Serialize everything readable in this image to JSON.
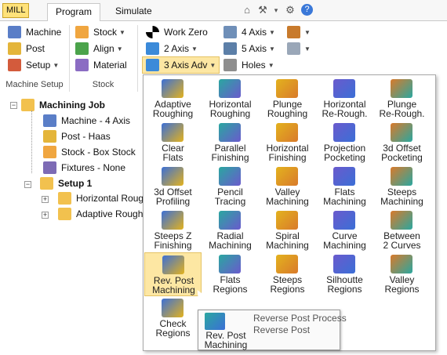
{
  "ribbon": {
    "app_badge": "MILL",
    "tabs": [
      {
        "label": "Program"
      },
      {
        "label": "Simulate"
      }
    ],
    "machine_setup": {
      "machine": "Machine",
      "post": "Post",
      "setup": "Setup",
      "group": "Machine Setup"
    },
    "stock": {
      "stock": "Stock",
      "align": "Align",
      "material": "Material",
      "group": "Stock"
    },
    "programming": {
      "work_zero": "Work Zero",
      "two_axis": "2 Axis",
      "three_axis_adv": "3 Axis Adv",
      "four_axis": "4 Axis",
      "five_axis": "5 Axis",
      "holes": "Holes"
    }
  },
  "tree": {
    "job": "Machining Job",
    "machine": "Machine - 4 Axis",
    "post": "Post - Haas",
    "stock": "Stock - Box Stock",
    "fixtures": "Fixtures - None",
    "setup": "Setup 1",
    "op1": "Horizontal Roug",
    "op2": "Adaptive Rough"
  },
  "menu": {
    "items": [
      {
        "label": "Adaptive\nRoughing",
        "icon": "adaptive-roughing-icon"
      },
      {
        "label": "Horizontal\nRoughing",
        "icon": "horizontal-roughing-icon"
      },
      {
        "label": "Plunge\nRoughing",
        "icon": "plunge-roughing-icon"
      },
      {
        "label": "Horizontal\nRe-Rough.",
        "icon": "horizontal-rerough-icon"
      },
      {
        "label": "Plunge\nRe-Rough.",
        "icon": "plunge-rerough-icon"
      },
      {
        "label": "Clear\nFlats",
        "icon": "clear-flats-icon"
      },
      {
        "label": "Parallel\nFinishing",
        "icon": "parallel-finishing-icon"
      },
      {
        "label": "Horizontal\nFinishing",
        "icon": "horizontal-finishing-icon"
      },
      {
        "label": "Projection\nPocketing",
        "icon": "projection-pocketing-icon"
      },
      {
        "label": "3d Offset\nPocketing",
        "icon": "3d-offset-pocketing-icon"
      },
      {
        "label": "3d Offset\nProfiling",
        "icon": "3d-offset-profiling-icon"
      },
      {
        "label": "Pencil\nTracing",
        "icon": "pencil-tracing-icon"
      },
      {
        "label": "Valley\nMachining",
        "icon": "valley-machining-icon"
      },
      {
        "label": "Flats\nMachining",
        "icon": "flats-machining-icon"
      },
      {
        "label": "Steeps\nMachining",
        "icon": "steeps-machining-icon"
      },
      {
        "label": "Steeps  Z\nFinishing",
        "icon": "steeps-z-finishing-icon"
      },
      {
        "label": "Radial\nMachining",
        "icon": "radial-machining-icon"
      },
      {
        "label": "Spiral\nMachining",
        "icon": "spiral-machining-icon"
      },
      {
        "label": "Curve\nMachining",
        "icon": "curve-machining-icon"
      },
      {
        "label": "Between\n2 Curves",
        "icon": "between-2-curves-icon"
      },
      {
        "label": "Rev. Post\nMachining",
        "icon": "rev-post-machining-icon"
      },
      {
        "label": "Flats\nRegions",
        "icon": "flats-regions-icon"
      },
      {
        "label": "Steeps\nRegions",
        "icon": "steeps-regions-icon"
      },
      {
        "label": "Silhoutte\nRegions",
        "icon": "silhouette-regions-icon"
      },
      {
        "label": "Valley\nRegions",
        "icon": "valley-regions-icon"
      },
      {
        "label": "Check\nRegions",
        "icon": "check-regions-icon"
      }
    ]
  },
  "tooltip": {
    "title": "Rev. Post\nMachining",
    "line1": "Reverse Post Process",
    "line2": "Reverse Post"
  },
  "colors": {
    "accent": "#fde7a3",
    "selected_border": "#e5c365",
    "ribbon_bg": "#f3f3f3",
    "icon_blue": "#3b6fd6",
    "icon_teal": "#2aa7a0",
    "icon_yellow": "#e3b21e"
  }
}
